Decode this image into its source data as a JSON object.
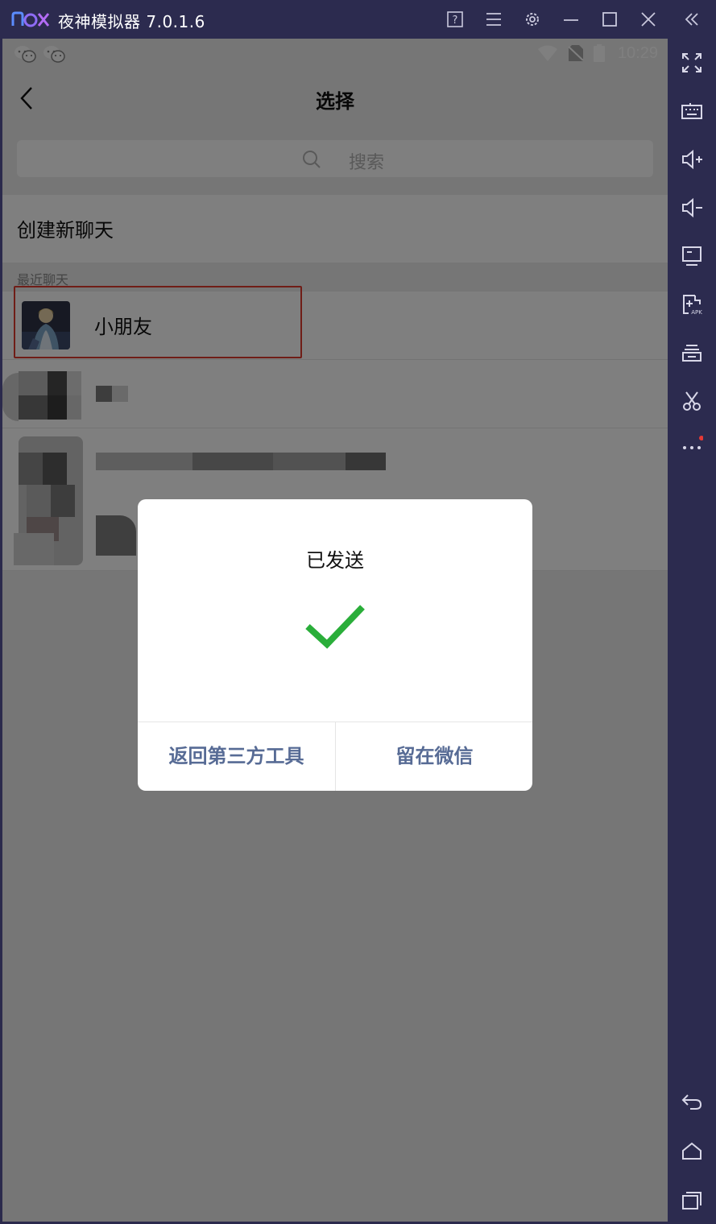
{
  "emulator": {
    "title": "夜神模拟器 7.0.1.6",
    "accent_color": "#2c2b4f",
    "title_icons": [
      "help-icon",
      "menu-icon",
      "settings-icon",
      "minimize-icon",
      "maximize-icon",
      "close-icon",
      "collapse-sidebar-icon"
    ],
    "sidebar_icons": [
      "fullscreen-icon",
      "keyboard-icon",
      "volume-up-icon",
      "volume-down-icon",
      "screen-icon",
      "add-apk-icon",
      "multi-instance-icon",
      "screenshot-icon",
      "more-icon",
      "back-nav-icon",
      "home-nav-icon",
      "recent-apps-icon"
    ]
  },
  "status_bar": {
    "time": "10:29",
    "icons": [
      "wechat-icon",
      "wechat-icon",
      "wifi-icon",
      "no-sim-icon",
      "battery-icon"
    ]
  },
  "page": {
    "title": "选择",
    "search_placeholder": "搜索",
    "new_chat_label": "创建新聊天",
    "recent_header": "最近聊天",
    "contacts": [
      {
        "name": "小朋友"
      }
    ]
  },
  "dialog": {
    "title": "已发送",
    "left_button": "返回第三方工具",
    "right_button": "留在微信",
    "check_color": "#2aae3a",
    "button_color": "#576b95"
  }
}
